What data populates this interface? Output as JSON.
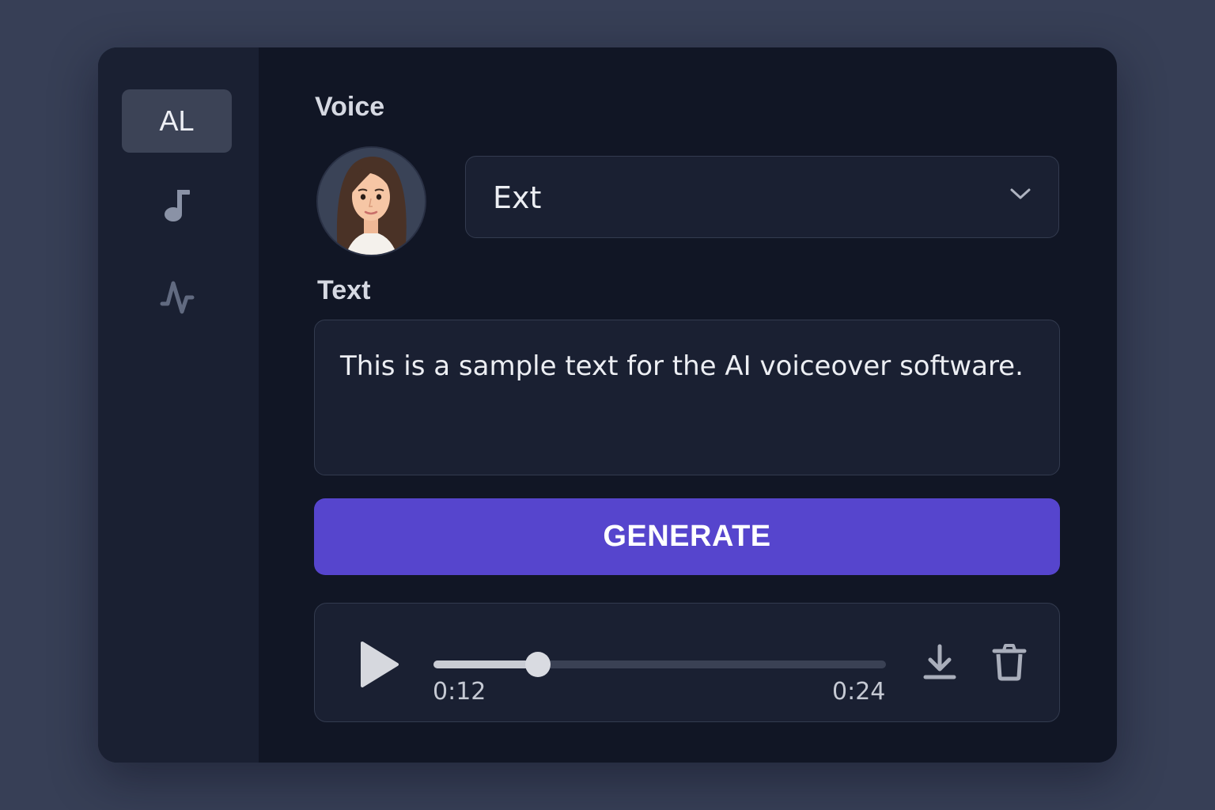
{
  "sidebar": {
    "items": [
      {
        "label": "AL",
        "active": true
      },
      {
        "icon": "music-note-icon"
      },
      {
        "icon": "waveform-icon"
      }
    ]
  },
  "voice": {
    "label": "Voice",
    "avatar_icon": "female-avatar",
    "selected": "Ext"
  },
  "text": {
    "label": "Text",
    "value": "This is a sample text for the AI voiceover software."
  },
  "generate_label": "GENERATE",
  "player": {
    "current_time": "0:12",
    "duration": "0:24",
    "progress": 0.23,
    "icons": [
      "play-icon",
      "download-icon",
      "trash-icon"
    ]
  },
  "colors": {
    "accent": "#5645cd",
    "background": "#373f56",
    "panel": "#111625",
    "sidebar": "#1a2032"
  }
}
